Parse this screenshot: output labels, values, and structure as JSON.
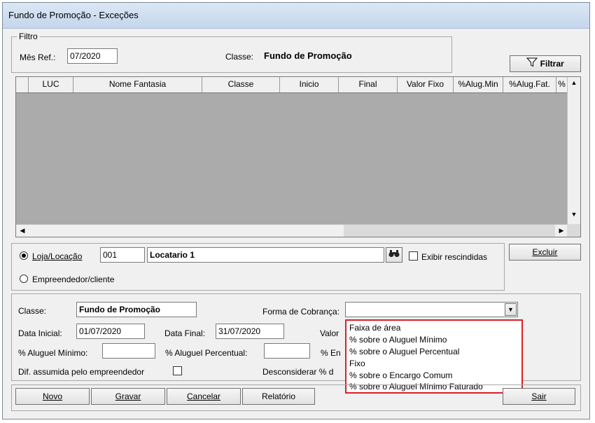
{
  "window": {
    "title": "Fundo de Promoção - Exceções"
  },
  "filter": {
    "legend": "Filtro",
    "mes_ref_label": "Mês Ref.:",
    "mes_ref_value": "07/2020",
    "classe_label": "Classe:",
    "classe_value": "Fundo de Promoção",
    "filtrar_label": "Filtrar"
  },
  "grid": {
    "columns": [
      "LUC",
      "Nome Fantasia",
      "Classe",
      "Inicio",
      "Final",
      "Valor Fixo",
      "%Alug.Min",
      "%Alug.Fat.",
      "%"
    ]
  },
  "selection": {
    "loja_label": "Loja/Locação",
    "loja_code": "001",
    "loja_name": "Locatario 1",
    "exibir_label": "Exibir rescindidas",
    "excluir_label": "Excluir",
    "empreendedor_label": "Empreendedor/cliente"
  },
  "form": {
    "classe_label": "Classe:",
    "classe_value": "Fundo de Promoção",
    "forma_label": "Forma de Cobrança:",
    "data_inicial_label": "Data Inicial:",
    "data_inicial_value": "01/07/2020",
    "data_final_label": "Data Final:",
    "data_final_value": "31/07/2020",
    "valor_label": "Valor",
    "aluguel_minimo_label": "% Aluguel Mínimo:",
    "aluguel_percentual_label": "% Aluguel Percentual:",
    "encargo_label": "% En",
    "dif_label": "Dif. assumida pelo empreendedor",
    "desconsiderar_label": "Desconsiderar % d"
  },
  "dropdown_options": [
    "Faixa de área",
    "% sobre o Aluguel Mínimo",
    "% sobre o Aluguel Percentual",
    "Fixo",
    "% sobre o Encargo Comum",
    "% sobre o Aluguel Mínimo Faturado"
  ],
  "buttons": {
    "novo": "Novo",
    "gravar": "Gravar",
    "cancelar": "Cancelar",
    "relatorio": "Relatório",
    "sair": "Sair"
  },
  "colors": {
    "highlight_border": "#d81f26",
    "grid_background": "#ababab"
  }
}
